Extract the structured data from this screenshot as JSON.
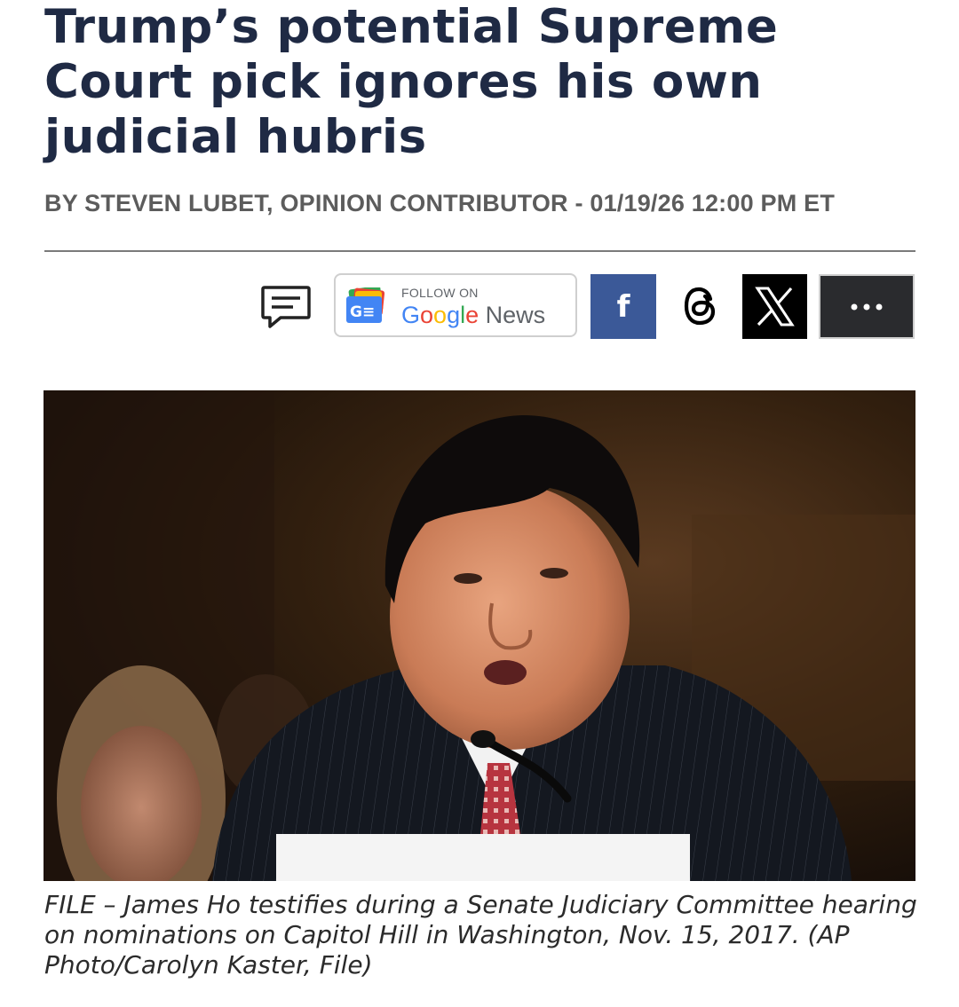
{
  "article": {
    "headline": "Trump’s potential Supreme Court pick ignores his own judicial hubris",
    "byline": "BY STEVEN LUBET, OPINION CONTRIBUTOR - 01/19/26 12:00 PM ET"
  },
  "share_bar": {
    "comment_icon": "comment-bubble-icon",
    "google_news": {
      "follow_label": "FOLLOW ON",
      "google_word": [
        "G",
        "o",
        "o",
        "g",
        "l",
        "e"
      ],
      "news_word": "News",
      "logo_text": "G≡"
    },
    "facebook": {
      "label": "f",
      "color": "#3b5998"
    },
    "threads": {
      "icon": "threads-icon"
    },
    "x": {
      "icon": "x-logo-icon",
      "color": "#000000"
    },
    "more": {
      "label": "•••",
      "color": "#2a2b2e"
    }
  },
  "photo": {
    "caption": "FILE – James Ho testifies during a Senate Judiciary Committee hearing on nominations on Capitol Hill in Washington, Nov. 15, 2017. (AP Photo/Carolyn Kaster, File)"
  },
  "colors": {
    "headline": "#1f2a44",
    "byline": "#5c5c5c",
    "caption": "#2b2b2b"
  }
}
